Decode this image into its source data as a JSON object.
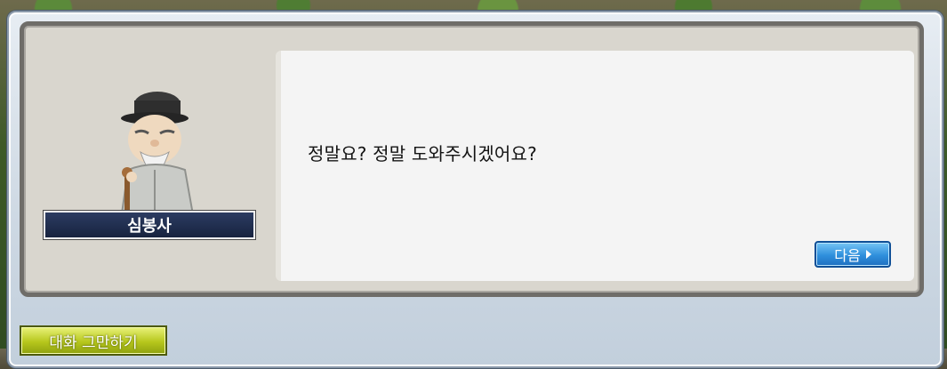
{
  "npc": {
    "name": "심봉사"
  },
  "dialogue": {
    "text": "정말요? 정말 도와주시겠어요?"
  },
  "buttons": {
    "next_label": "다음",
    "end_chat_label": "대화 그만하기"
  },
  "colors": {
    "next_button": "#2f8fdc",
    "end_chat_button": "#b7c71c",
    "name_plate": "#17233f"
  }
}
